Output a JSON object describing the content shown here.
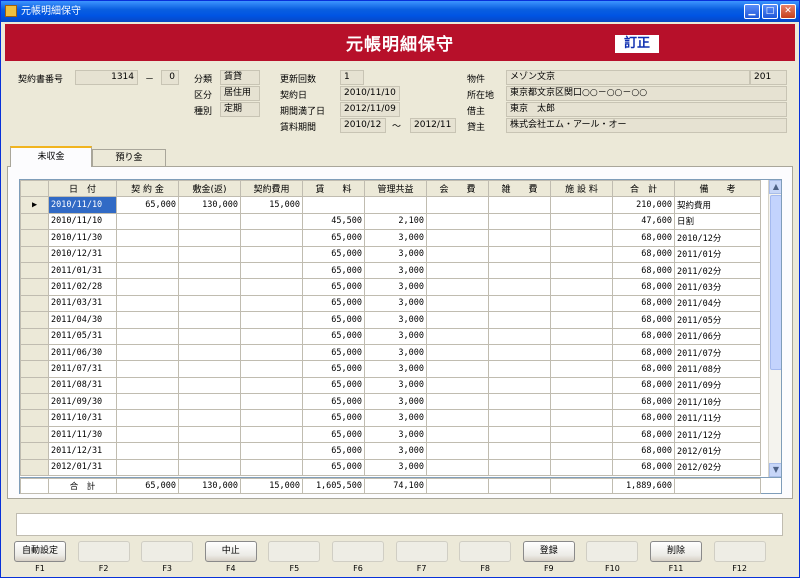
{
  "window": {
    "title": "元帳明細保守"
  },
  "banner": {
    "title": "元帳明細保守",
    "badge": "訂正"
  },
  "header": {
    "contract_no_label": "契約書番号",
    "contract_no": "1314",
    "contract_dash": "－",
    "contract_sub": "0",
    "category_label": "分類",
    "category": "賃貸",
    "division_label": "区分",
    "division": "居住用",
    "kind_label": "種別",
    "kind": "定期",
    "renewal_label": "更新回数",
    "renewal": "1",
    "contract_date_label": "契約日",
    "contract_date": "2010/11/10",
    "expiry_label": "期間満了日",
    "expiry": "2012/11/09",
    "rent_period_label": "賃料期間",
    "rent_from": "2010/12",
    "rent_tilde": "～",
    "rent_to": "2012/11",
    "property_label": "物件",
    "property": "メゾン文京",
    "room": "201",
    "address_label": "所在地",
    "address": "東京都文京区関口○○－○○－○○",
    "tenant_label": "借主",
    "tenant": "東京　太郎",
    "landlord_label": "貸主",
    "landlord": "株式会社エム・アール・オー"
  },
  "tabs": [
    {
      "label": "未収金"
    },
    {
      "label": "預り金"
    }
  ],
  "grid": {
    "columns": [
      "日　付",
      "契 約 金",
      "敷金(返)",
      "契約費用",
      "賃　　料",
      "管理共益",
      "会　　費",
      "雑　　費",
      "施 設 料",
      "合　計",
      "備　　考"
    ],
    "rows": [
      [
        "2010/11/10",
        "65,000",
        "130,000",
        "15,000",
        "",
        "",
        "",
        "",
        "",
        "210,000",
        "契約費用"
      ],
      [
        "2010/11/10",
        "",
        "",
        "",
        "45,500",
        "2,100",
        "",
        "",
        "",
        "47,600",
        "日割"
      ],
      [
        "2010/11/30",
        "",
        "",
        "",
        "65,000",
        "3,000",
        "",
        "",
        "",
        "68,000",
        "2010/12分"
      ],
      [
        "2010/12/31",
        "",
        "",
        "",
        "65,000",
        "3,000",
        "",
        "",
        "",
        "68,000",
        "2011/01分"
      ],
      [
        "2011/01/31",
        "",
        "",
        "",
        "65,000",
        "3,000",
        "",
        "",
        "",
        "68,000",
        "2011/02分"
      ],
      [
        "2011/02/28",
        "",
        "",
        "",
        "65,000",
        "3,000",
        "",
        "",
        "",
        "68,000",
        "2011/03分"
      ],
      [
        "2011/03/31",
        "",
        "",
        "",
        "65,000",
        "3,000",
        "",
        "",
        "",
        "68,000",
        "2011/04分"
      ],
      [
        "2011/04/30",
        "",
        "",
        "",
        "65,000",
        "3,000",
        "",
        "",
        "",
        "68,000",
        "2011/05分"
      ],
      [
        "2011/05/31",
        "",
        "",
        "",
        "65,000",
        "3,000",
        "",
        "",
        "",
        "68,000",
        "2011/06分"
      ],
      [
        "2011/06/30",
        "",
        "",
        "",
        "65,000",
        "3,000",
        "",
        "",
        "",
        "68,000",
        "2011/07分"
      ],
      [
        "2011/07/31",
        "",
        "",
        "",
        "65,000",
        "3,000",
        "",
        "",
        "",
        "68,000",
        "2011/08分"
      ],
      [
        "2011/08/31",
        "",
        "",
        "",
        "65,000",
        "3,000",
        "",
        "",
        "",
        "68,000",
        "2011/09分"
      ],
      [
        "2011/09/30",
        "",
        "",
        "",
        "65,000",
        "3,000",
        "",
        "",
        "",
        "68,000",
        "2011/10分"
      ],
      [
        "2011/10/31",
        "",
        "",
        "",
        "65,000",
        "3,000",
        "",
        "",
        "",
        "68,000",
        "2011/11分"
      ],
      [
        "2011/11/30",
        "",
        "",
        "",
        "65,000",
        "3,000",
        "",
        "",
        "",
        "68,000",
        "2011/12分"
      ],
      [
        "2011/12/31",
        "",
        "",
        "",
        "65,000",
        "3,000",
        "",
        "",
        "",
        "68,000",
        "2012/01分"
      ],
      [
        "2012/01/31",
        "",
        "",
        "",
        "65,000",
        "3,000",
        "",
        "",
        "",
        "68,000",
        "2012/02分"
      ]
    ],
    "current_row_marker": "▶",
    "totals": [
      "合　計",
      "65,000",
      "130,000",
      "15,000",
      "1,605,500",
      "74,100",
      "",
      "",
      "",
      "1,889,600",
      ""
    ]
  },
  "fkeys": [
    {
      "label": "自動設定",
      "key": "F1",
      "enabled": true
    },
    {
      "label": "",
      "key": "F2",
      "enabled": false
    },
    {
      "label": "",
      "key": "F3",
      "enabled": false
    },
    {
      "label": "中止",
      "key": "F4",
      "enabled": true
    },
    {
      "label": "",
      "key": "F5",
      "enabled": false
    },
    {
      "label": "",
      "key": "F6",
      "enabled": false
    },
    {
      "label": "",
      "key": "F7",
      "enabled": false
    },
    {
      "label": "",
      "key": "F8",
      "enabled": false
    },
    {
      "label": "登録",
      "key": "F9",
      "enabled": true
    },
    {
      "label": "",
      "key": "F10",
      "enabled": false
    },
    {
      "label": "削除",
      "key": "F11",
      "enabled": true
    },
    {
      "label": "",
      "key": "F12",
      "enabled": false
    }
  ],
  "colors": {
    "banner": "#b7102a",
    "titlebar": "#0054e3",
    "selection": "#316ac5"
  }
}
